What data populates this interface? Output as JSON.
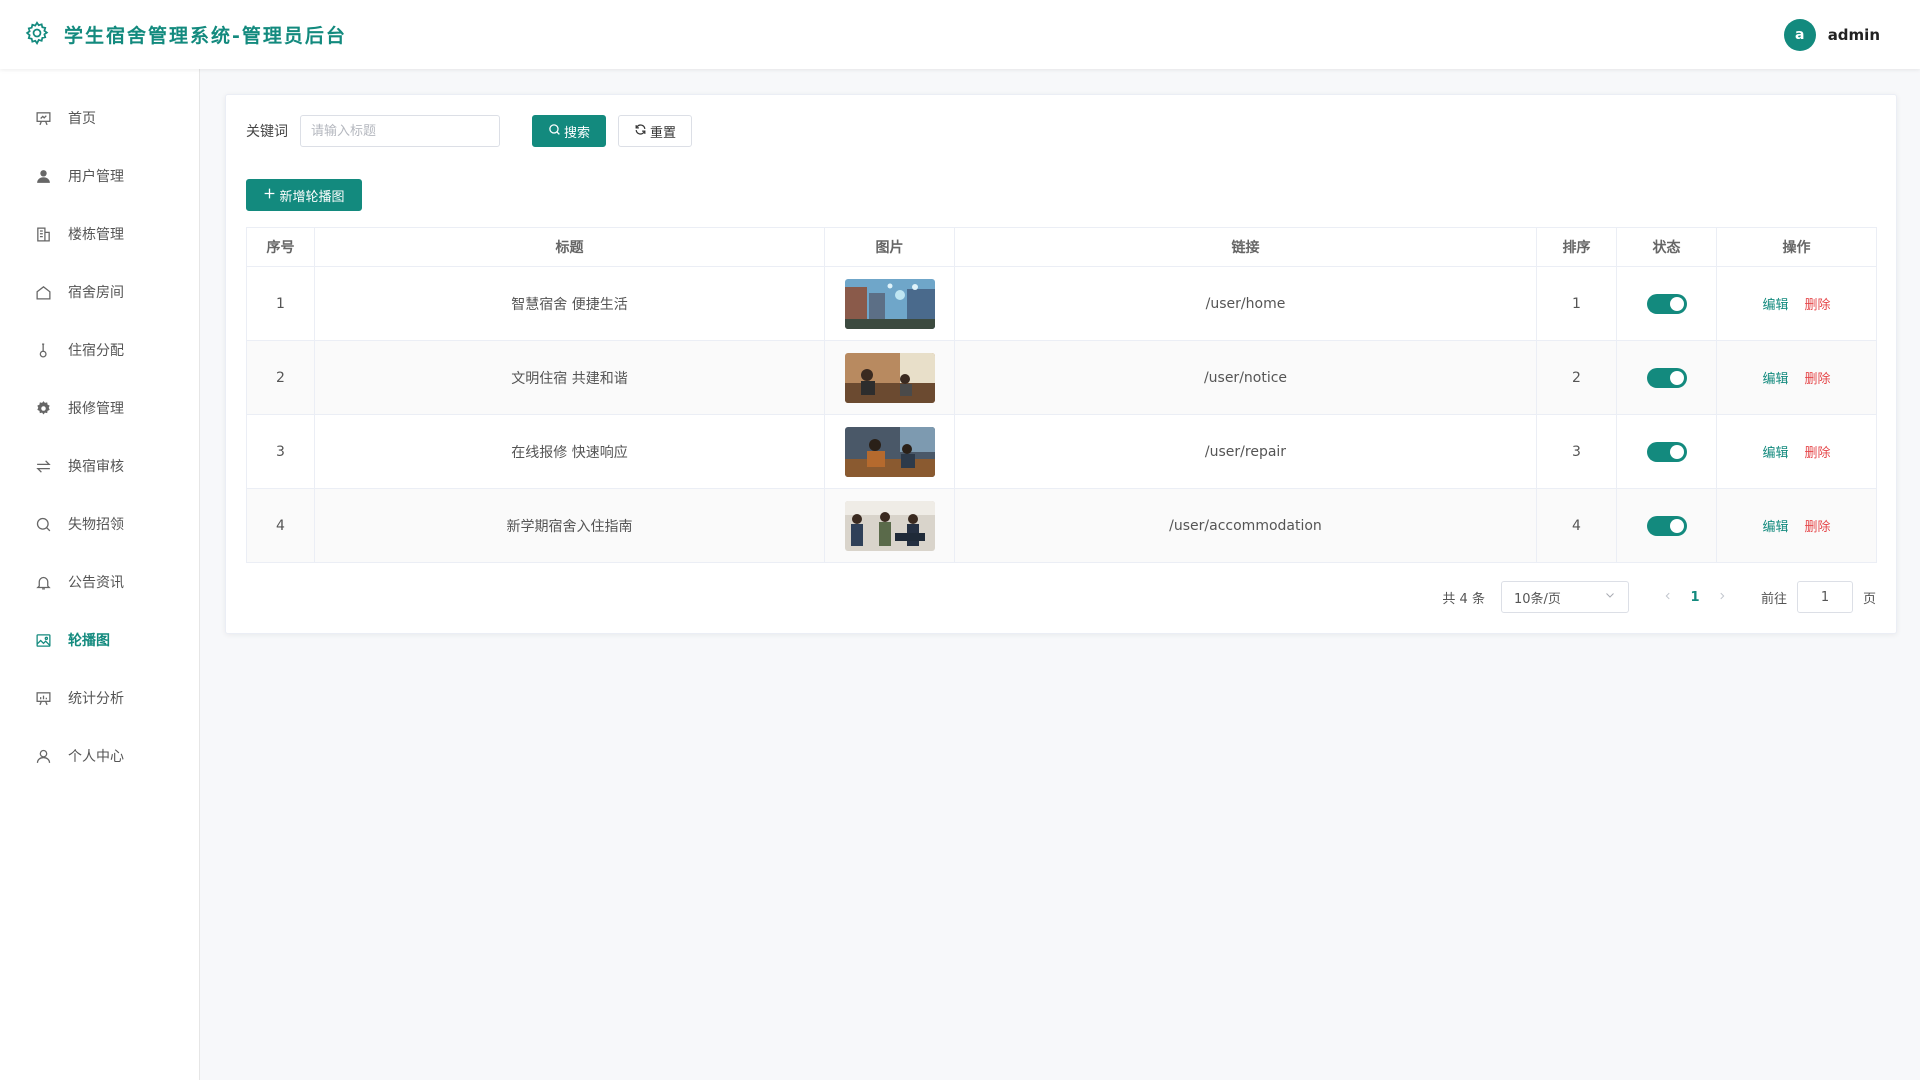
{
  "header": {
    "title": "学生宿舍管理系统-管理员后台",
    "avatar_letter": "a",
    "username": "admin",
    "accent": "#138a7e"
  },
  "sidebar": {
    "items": [
      {
        "label": "首页",
        "icon": "presentation-board-icon"
      },
      {
        "label": "用户管理",
        "icon": "user-solid-icon"
      },
      {
        "label": "楼栋管理",
        "icon": "building-icon"
      },
      {
        "label": "宿舍房间",
        "icon": "house-icon"
      },
      {
        "label": "住宿分配",
        "icon": "thermometer-icon"
      },
      {
        "label": "报修管理",
        "icon": "gear-icon"
      },
      {
        "label": "换宿审核",
        "icon": "swap-arrows-icon"
      },
      {
        "label": "失物招领",
        "icon": "search-icon"
      },
      {
        "label": "公告资讯",
        "icon": "bell-icon"
      },
      {
        "label": "轮播图",
        "icon": "image-icon",
        "active": true
      },
      {
        "label": "统计分析",
        "icon": "chart-board-icon"
      },
      {
        "label": "个人中心",
        "icon": "user-outline-icon"
      }
    ]
  },
  "search": {
    "label": "关键词",
    "placeholder": "请输入标题",
    "value": "",
    "search_button": "搜索",
    "reset_button": "重置"
  },
  "toolbar": {
    "add_button": "新增轮播图"
  },
  "table": {
    "columns": [
      "序号",
      "标题",
      "图片",
      "链接",
      "排序",
      "状态",
      "操作"
    ],
    "rows": [
      {
        "index": "1",
        "title": "智慧宿舍 便捷生活",
        "link": "/user/home",
        "sort": "1",
        "enabled": true
      },
      {
        "index": "2",
        "title": "文明住宿 共建和谐",
        "link": "/user/notice",
        "sort": "2",
        "enabled": true
      },
      {
        "index": "3",
        "title": "在线报修 快速响应",
        "link": "/user/repair",
        "sort": "3",
        "enabled": true
      },
      {
        "index": "4",
        "title": "新学期宿舍入住指南",
        "link": "/user/accommodation",
        "sort": "4",
        "enabled": true
      }
    ],
    "edit_label": "编辑",
    "delete_label": "删除"
  },
  "pagination": {
    "total_text": "共 4 条",
    "page_size": "10条/页",
    "current_page": "1",
    "goto_label": "前往",
    "goto_value": "1",
    "page_suffix": "页"
  }
}
